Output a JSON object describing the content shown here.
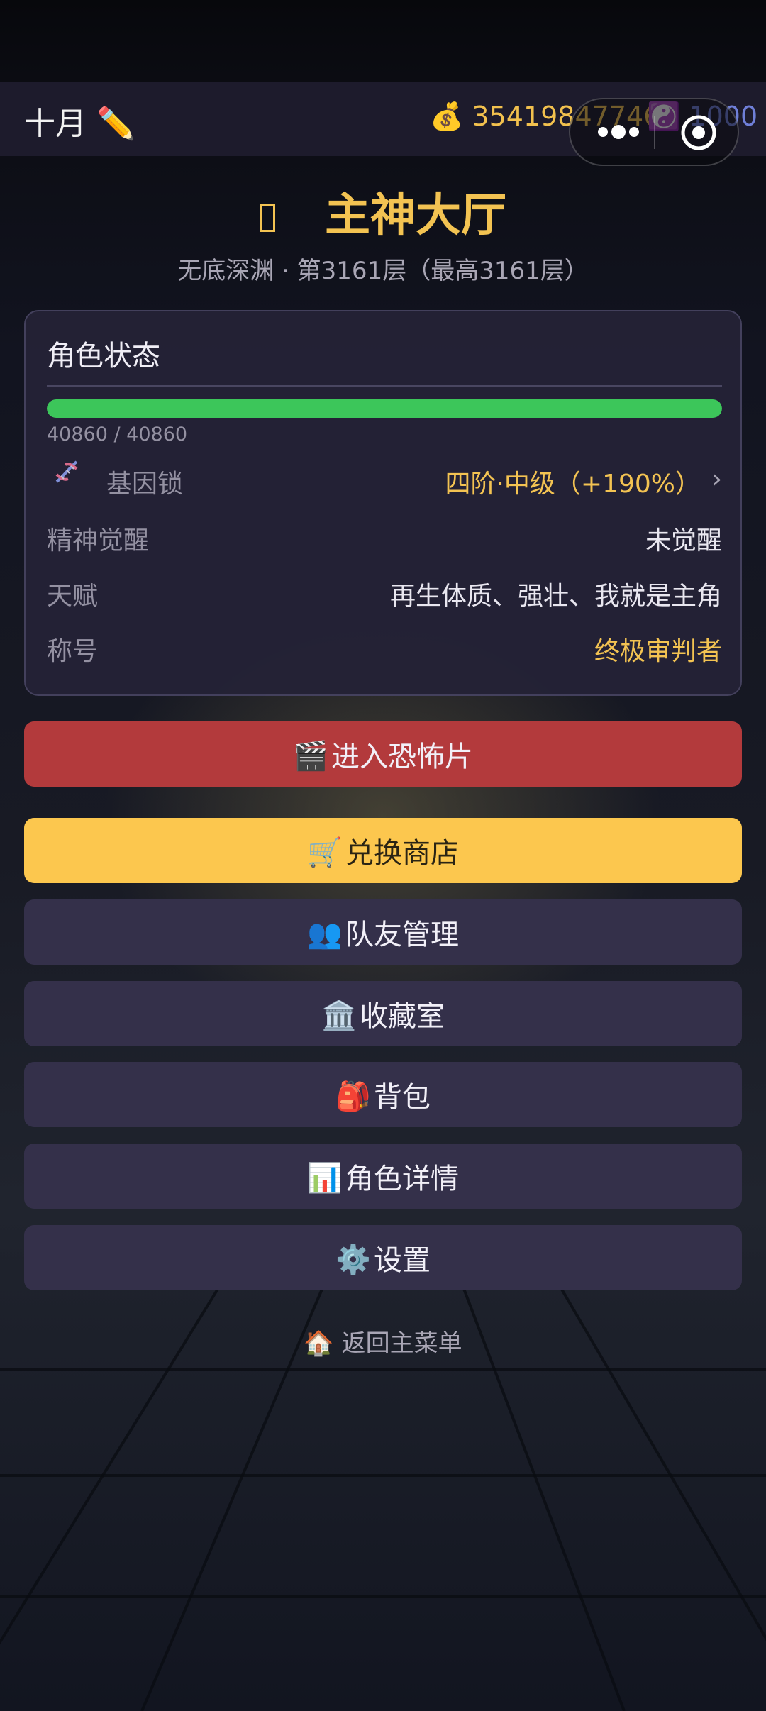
{
  "topbar": {
    "month": "十月",
    "coins": "35419847746",
    "gems": "1000"
  },
  "header": {
    "title": "主神大厅",
    "subtitle": "无底深渊 · 第3161层（最高3161层）"
  },
  "status": {
    "title": "角色状态",
    "hp": {
      "text": "40860 / 40860",
      "fraction": 1.0
    },
    "gene_lock": {
      "label": "基因锁",
      "value": "四阶·中级（+190%）"
    },
    "spirit": {
      "label": "精神觉醒",
      "value": "未觉醒"
    },
    "talent": {
      "label": "天赋",
      "value": "再生体质、强壮、我就是主角"
    },
    "title_row": {
      "label": "称号",
      "value": "终极审判者"
    }
  },
  "menu": {
    "enter_horror": "进入恐怖片",
    "shop": "兑换商店",
    "teammates": "队友管理",
    "collection": "收藏室",
    "backpack": "背包",
    "character": "角色详情",
    "settings": "设置",
    "back": "返回主菜单"
  },
  "colors": {
    "accent_gold": "#f3c352",
    "hp_green": "#3cc65a",
    "enter_red": "#b33a3c",
    "shop_yellow": "#fcc74e",
    "button_dark": "#34304a"
  }
}
